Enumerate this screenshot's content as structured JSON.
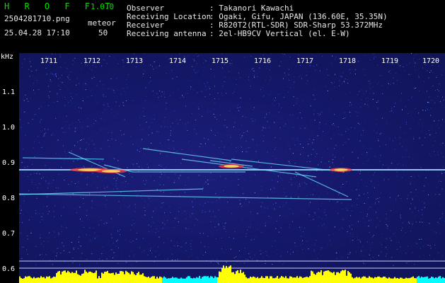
{
  "app": {
    "name": "H R O F F T",
    "version": "1.0.0"
  },
  "capture": {
    "filename": "2504281710.png",
    "datetime": "25.04.28 17:10",
    "meteor_label": "meteor",
    "meteor_count": "50"
  },
  "station": {
    "observer_label": "Observer",
    "observer_value": ": Takanori Kawachi",
    "location_label": "Receiving Location",
    "location_value": ": Ogaki, Gifu, JAPAN (136.60E, 35.35N)",
    "receiver_label": "Receiver",
    "receiver_value": ": R820T2(RTL-SDR) SDR-Sharp 53.372MHz",
    "antenna_label": "Receiving antenna",
    "antenna_value": ": 2el-HB9CV Vertical (el. E-W)"
  },
  "axes": {
    "y_unit": "kHz",
    "y_ticks": [
      "1.1",
      "1.0",
      "0.9",
      "0.8",
      "0.7",
      "0.6"
    ],
    "x_ticks": [
      "1711",
      "1712",
      "1713",
      "1714",
      "1715",
      "1716",
      "1717",
      "1718",
      "1719",
      "1720"
    ]
  },
  "colors": {
    "background": "#000000",
    "title_green": "#00e000",
    "spectrum_bg": "#141868",
    "carrier": "#9fd6ff",
    "echo_hot": "#ff3a3a",
    "level_yellow": "#ffff00",
    "level_cyan": "#00ffff"
  }
}
